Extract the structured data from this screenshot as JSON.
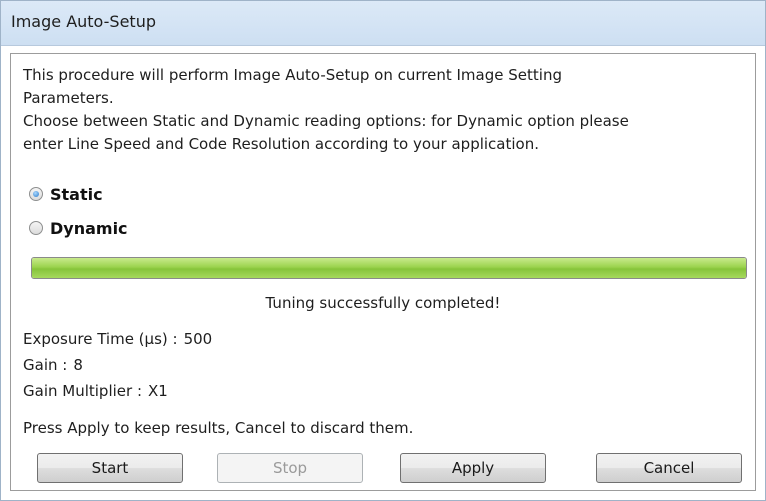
{
  "window": {
    "title": "Image Auto-Setup"
  },
  "description": {
    "line1": "This procedure will perform Image Auto-Setup on current Image Setting",
    "line2": "Parameters.",
    "line3": "Choose between Static and Dynamic reading options: for Dynamic option please",
    "line4": "enter Line Speed and Code Resolution according to your application."
  },
  "mode": {
    "options": [
      {
        "label": "Static",
        "selected": true
      },
      {
        "label": "Dynamic",
        "selected": false
      }
    ]
  },
  "progress": {
    "value_percent": 100,
    "fill_color": "#9bd34e"
  },
  "status": "Tuning successfully completed!",
  "results": {
    "exposure": {
      "label": "Exposure Time (µs) :",
      "value": "500"
    },
    "gain": {
      "label": "Gain :",
      "value": "8"
    },
    "gain_multiplier": {
      "label": "Gain Multiplier :",
      "value": "X1"
    }
  },
  "hint": "Press Apply to keep results, Cancel to discard them.",
  "buttons": {
    "start": {
      "label": "Start",
      "enabled": true
    },
    "stop": {
      "label": "Stop",
      "enabled": false
    },
    "apply": {
      "label": "Apply",
      "enabled": true
    },
    "cancel": {
      "label": "Cancel",
      "enabled": true
    }
  }
}
